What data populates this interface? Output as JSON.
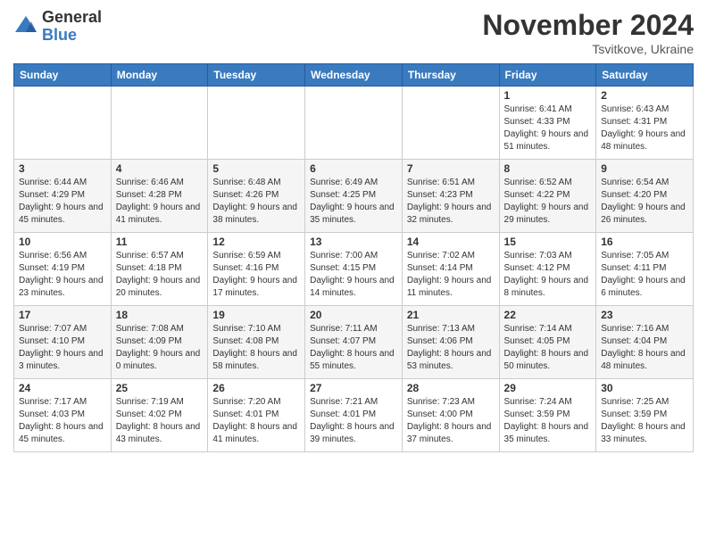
{
  "logo": {
    "general": "General",
    "blue": "Blue"
  },
  "header": {
    "month": "November 2024",
    "location": "Tsvitkove, Ukraine"
  },
  "weekdays": [
    "Sunday",
    "Monday",
    "Tuesday",
    "Wednesday",
    "Thursday",
    "Friday",
    "Saturday"
  ],
  "weeks": [
    [
      {
        "day": "",
        "sunrise": "",
        "sunset": "",
        "daylight": ""
      },
      {
        "day": "",
        "sunrise": "",
        "sunset": "",
        "daylight": ""
      },
      {
        "day": "",
        "sunrise": "",
        "sunset": "",
        "daylight": ""
      },
      {
        "day": "",
        "sunrise": "",
        "sunset": "",
        "daylight": ""
      },
      {
        "day": "",
        "sunrise": "",
        "sunset": "",
        "daylight": ""
      },
      {
        "day": "1",
        "sunrise": "Sunrise: 6:41 AM",
        "sunset": "Sunset: 4:33 PM",
        "daylight": "Daylight: 9 hours and 51 minutes."
      },
      {
        "day": "2",
        "sunrise": "Sunrise: 6:43 AM",
        "sunset": "Sunset: 4:31 PM",
        "daylight": "Daylight: 9 hours and 48 minutes."
      }
    ],
    [
      {
        "day": "3",
        "sunrise": "Sunrise: 6:44 AM",
        "sunset": "Sunset: 4:29 PM",
        "daylight": "Daylight: 9 hours and 45 minutes."
      },
      {
        "day": "4",
        "sunrise": "Sunrise: 6:46 AM",
        "sunset": "Sunset: 4:28 PM",
        "daylight": "Daylight: 9 hours and 41 minutes."
      },
      {
        "day": "5",
        "sunrise": "Sunrise: 6:48 AM",
        "sunset": "Sunset: 4:26 PM",
        "daylight": "Daylight: 9 hours and 38 minutes."
      },
      {
        "day": "6",
        "sunrise": "Sunrise: 6:49 AM",
        "sunset": "Sunset: 4:25 PM",
        "daylight": "Daylight: 9 hours and 35 minutes."
      },
      {
        "day": "7",
        "sunrise": "Sunrise: 6:51 AM",
        "sunset": "Sunset: 4:23 PM",
        "daylight": "Daylight: 9 hours and 32 minutes."
      },
      {
        "day": "8",
        "sunrise": "Sunrise: 6:52 AM",
        "sunset": "Sunset: 4:22 PM",
        "daylight": "Daylight: 9 hours and 29 minutes."
      },
      {
        "day": "9",
        "sunrise": "Sunrise: 6:54 AM",
        "sunset": "Sunset: 4:20 PM",
        "daylight": "Daylight: 9 hours and 26 minutes."
      }
    ],
    [
      {
        "day": "10",
        "sunrise": "Sunrise: 6:56 AM",
        "sunset": "Sunset: 4:19 PM",
        "daylight": "Daylight: 9 hours and 23 minutes."
      },
      {
        "day": "11",
        "sunrise": "Sunrise: 6:57 AM",
        "sunset": "Sunset: 4:18 PM",
        "daylight": "Daylight: 9 hours and 20 minutes."
      },
      {
        "day": "12",
        "sunrise": "Sunrise: 6:59 AM",
        "sunset": "Sunset: 4:16 PM",
        "daylight": "Daylight: 9 hours and 17 minutes."
      },
      {
        "day": "13",
        "sunrise": "Sunrise: 7:00 AM",
        "sunset": "Sunset: 4:15 PM",
        "daylight": "Daylight: 9 hours and 14 minutes."
      },
      {
        "day": "14",
        "sunrise": "Sunrise: 7:02 AM",
        "sunset": "Sunset: 4:14 PM",
        "daylight": "Daylight: 9 hours and 11 minutes."
      },
      {
        "day": "15",
        "sunrise": "Sunrise: 7:03 AM",
        "sunset": "Sunset: 4:12 PM",
        "daylight": "Daylight: 9 hours and 8 minutes."
      },
      {
        "day": "16",
        "sunrise": "Sunrise: 7:05 AM",
        "sunset": "Sunset: 4:11 PM",
        "daylight": "Daylight: 9 hours and 6 minutes."
      }
    ],
    [
      {
        "day": "17",
        "sunrise": "Sunrise: 7:07 AM",
        "sunset": "Sunset: 4:10 PM",
        "daylight": "Daylight: 9 hours and 3 minutes."
      },
      {
        "day": "18",
        "sunrise": "Sunrise: 7:08 AM",
        "sunset": "Sunset: 4:09 PM",
        "daylight": "Daylight: 9 hours and 0 minutes."
      },
      {
        "day": "19",
        "sunrise": "Sunrise: 7:10 AM",
        "sunset": "Sunset: 4:08 PM",
        "daylight": "Daylight: 8 hours and 58 minutes."
      },
      {
        "day": "20",
        "sunrise": "Sunrise: 7:11 AM",
        "sunset": "Sunset: 4:07 PM",
        "daylight": "Daylight: 8 hours and 55 minutes."
      },
      {
        "day": "21",
        "sunrise": "Sunrise: 7:13 AM",
        "sunset": "Sunset: 4:06 PM",
        "daylight": "Daylight: 8 hours and 53 minutes."
      },
      {
        "day": "22",
        "sunrise": "Sunrise: 7:14 AM",
        "sunset": "Sunset: 4:05 PM",
        "daylight": "Daylight: 8 hours and 50 minutes."
      },
      {
        "day": "23",
        "sunrise": "Sunrise: 7:16 AM",
        "sunset": "Sunset: 4:04 PM",
        "daylight": "Daylight: 8 hours and 48 minutes."
      }
    ],
    [
      {
        "day": "24",
        "sunrise": "Sunrise: 7:17 AM",
        "sunset": "Sunset: 4:03 PM",
        "daylight": "Daylight: 8 hours and 45 minutes."
      },
      {
        "day": "25",
        "sunrise": "Sunrise: 7:19 AM",
        "sunset": "Sunset: 4:02 PM",
        "daylight": "Daylight: 8 hours and 43 minutes."
      },
      {
        "day": "26",
        "sunrise": "Sunrise: 7:20 AM",
        "sunset": "Sunset: 4:01 PM",
        "daylight": "Daylight: 8 hours and 41 minutes."
      },
      {
        "day": "27",
        "sunrise": "Sunrise: 7:21 AM",
        "sunset": "Sunset: 4:01 PM",
        "daylight": "Daylight: 8 hours and 39 minutes."
      },
      {
        "day": "28",
        "sunrise": "Sunrise: 7:23 AM",
        "sunset": "Sunset: 4:00 PM",
        "daylight": "Daylight: 8 hours and 37 minutes."
      },
      {
        "day": "29",
        "sunrise": "Sunrise: 7:24 AM",
        "sunset": "Sunset: 3:59 PM",
        "daylight": "Daylight: 8 hours and 35 minutes."
      },
      {
        "day": "30",
        "sunrise": "Sunrise: 7:25 AM",
        "sunset": "Sunset: 3:59 PM",
        "daylight": "Daylight: 8 hours and 33 minutes."
      }
    ]
  ]
}
